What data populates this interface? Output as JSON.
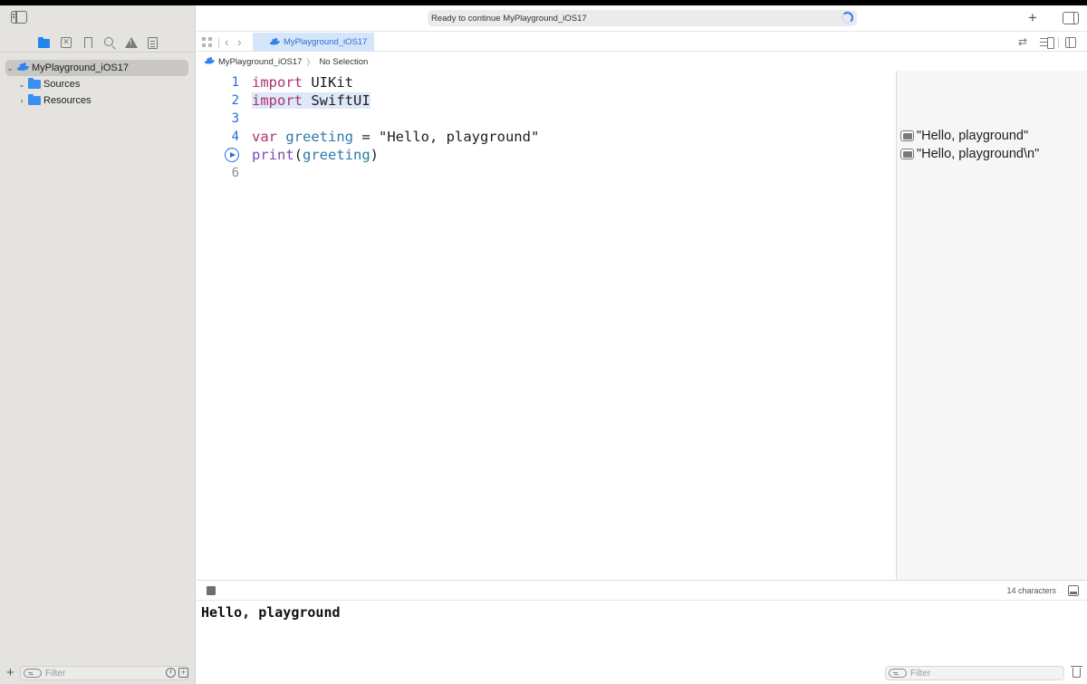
{
  "window": {
    "activity_status": "Ready to continue MyPlayground_iOS17"
  },
  "sidebar": {
    "tree": [
      {
        "label": "MyPlayground_iOS17",
        "expanded": true,
        "selected": true
      },
      {
        "label": "Sources",
        "expanded": true
      },
      {
        "label": "Resources",
        "expanded": false
      }
    ],
    "filter_placeholder": "Filter",
    "navigator_icons": [
      "folder-icon",
      "source-control-icon",
      "bookmark-icon",
      "search-icon",
      "warning-icon",
      "report-icon"
    ]
  },
  "tabs": [
    {
      "label": "MyPlayground_iOS17",
      "active": true
    }
  ],
  "jumpbar": {
    "file": "MyPlayground_iOS17",
    "selection": "No Selection"
  },
  "editor": {
    "line_numbers": [
      "1",
      "2",
      "3",
      "4",
      "",
      "6"
    ],
    "lines": [
      {
        "kw": "import",
        "rest": " UIKit"
      },
      {
        "kw": "import",
        "rest": " SwiftUI"
      },
      {
        "kw": "",
        "rest": ""
      },
      {
        "kw": "var",
        "id": " greeting",
        "rest": " = \"Hello, playground\""
      },
      {
        "fn": "print",
        "open": "(",
        "arg": "greeting",
        "close": ")"
      },
      {
        "kw": "",
        "rest": ""
      }
    ]
  },
  "results": [
    "\"Hello, playground\"",
    "\"Hello, playground\\n\""
  ],
  "debug": {
    "char_count": "14 characters",
    "console_output": "Hello, playground",
    "filter_placeholder": "Filter"
  },
  "colors": {
    "keyword": "#b0316e",
    "identifier": "#2b7aa8",
    "function": "#7d4bb3",
    "accent": "#1d6fd6"
  }
}
